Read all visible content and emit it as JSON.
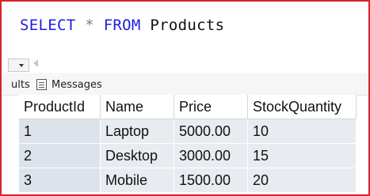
{
  "editor": {
    "tokens": {
      "select": "SELECT",
      "star": "*",
      "from": "FROM",
      "table": "Products"
    }
  },
  "results_tabs": [
    {
      "label": "ults",
      "icon": "grid-icon"
    },
    {
      "label": "Messages",
      "icon": "messages-icon"
    }
  ],
  "grid": {
    "columns": [
      "ProductId",
      "Name",
      "Price",
      "StockQuantity"
    ],
    "rows": [
      [
        "1",
        "Laptop",
        "5000.00",
        "10"
      ],
      [
        "2",
        "Desktop",
        "3000.00",
        "15"
      ],
      [
        "3",
        "Mobile",
        "1500.00",
        "20"
      ]
    ]
  },
  "colors": {
    "frame_border": "#d9232a",
    "keyword": "#1d1de0",
    "row_background": "#e8ecf1"
  }
}
